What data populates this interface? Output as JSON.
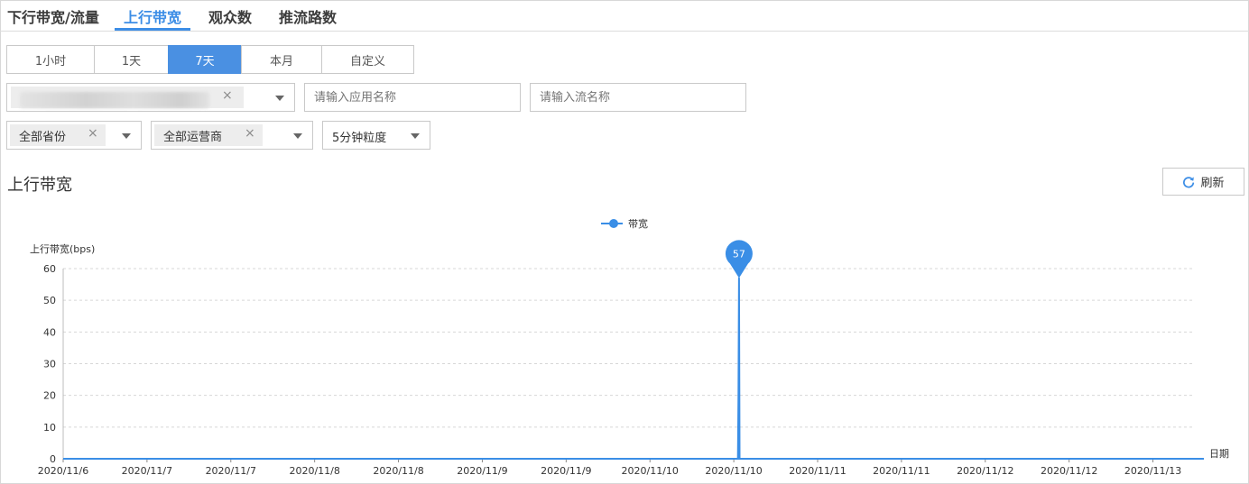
{
  "tabs": [
    {
      "label": "下行带宽/流量",
      "active": false
    },
    {
      "label": "上行带宽",
      "active": true
    },
    {
      "label": "观众数",
      "active": false
    },
    {
      "label": "推流路数",
      "active": false
    }
  ],
  "time_ranges": [
    {
      "label": "1小时",
      "active": false
    },
    {
      "label": "1天",
      "active": false
    },
    {
      "label": "7天",
      "active": true
    },
    {
      "label": "本月",
      "active": false
    },
    {
      "label": "自定义",
      "active": false
    }
  ],
  "filters": {
    "domain_select": {
      "remove_icon": "×",
      "redacted": true
    },
    "app_input": {
      "placeholder": "请输入应用名称",
      "value": ""
    },
    "stream_input": {
      "placeholder": "请输入流名称",
      "value": ""
    },
    "province_select": {
      "tag": "全部省份",
      "remove_icon": "×"
    },
    "isp_select": {
      "tag": "全部运营商",
      "remove_icon": "×"
    },
    "granularity_select": {
      "value": "5分钟粒度"
    }
  },
  "section": {
    "title": "上行带宽",
    "refresh_label": "刷新",
    "refresh_icon": "refresh-icon"
  },
  "colors": {
    "accent": "#3d8ee6",
    "series": "#3a8ee6"
  },
  "chart_data": {
    "type": "line",
    "title": "",
    "legend": [
      "带宽"
    ],
    "legend_position": "top-center",
    "ylabel": "上行带宽(bps)",
    "xlabel": "日期",
    "ylim": [
      0,
      60
    ],
    "y_ticks": [
      0,
      10,
      20,
      30,
      40,
      50,
      60
    ],
    "x_tick_labels": [
      "2020/11/6",
      "2020/11/7",
      "2020/11/7",
      "2020/11/8",
      "2020/11/8",
      "2020/11/9",
      "2020/11/9",
      "2020/11/10",
      "2020/11/10",
      "2020/11/11",
      "2020/11/11",
      "2020/11/12",
      "2020/11/12",
      "2020/11/13"
    ],
    "x_start": "2020/11/6 00:00",
    "x_end": "2020/11/13 00:00",
    "grid": true,
    "series": [
      {
        "name": "带宽",
        "points": [
          {
            "x": "2020/11/6 00:00",
            "y": 0
          },
          {
            "x": "2020/11/10 04:10",
            "y": 0
          },
          {
            "x": "2020/11/10 04:15",
            "y": 20
          },
          {
            "x": "2020/11/10 04:20",
            "y": 57
          },
          {
            "x": "2020/11/10 04:25",
            "y": 0
          },
          {
            "x": "2020/11/13 00:00",
            "y": 0
          }
        ]
      }
    ],
    "annotations": [
      {
        "type": "max_marker",
        "x": "2020/11/10 04:20",
        "y": 57,
        "label": "57"
      }
    ]
  }
}
